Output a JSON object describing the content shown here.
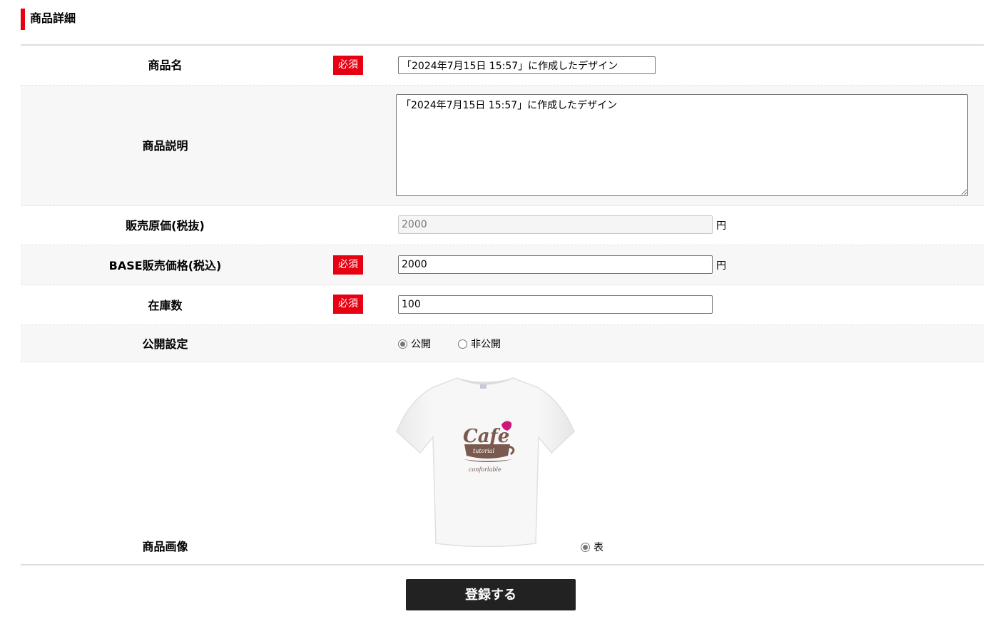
{
  "section_title": "商品詳細",
  "required_badge": "必須",
  "fields": {
    "name": {
      "label": "商品名",
      "value": "「2024年7月15日 15:57」に作成したデザイン"
    },
    "description": {
      "label": "商品説明",
      "value": "「2024年7月15日 15:57」に作成したデザイン"
    },
    "base_price": {
      "label": "販売原価(税抜)",
      "value": "2000",
      "unit": "円"
    },
    "sale_price": {
      "label": "BASE販売価格(税込)",
      "value": "2000",
      "unit": "円"
    },
    "stock": {
      "label": "在庫数",
      "value": "100"
    },
    "visibility": {
      "label": "公開設定",
      "options": [
        "公開",
        "非公開"
      ],
      "selected": "公開"
    },
    "image": {
      "label": "商品画像",
      "side_option": "表",
      "print_text": [
        "Cafe",
        "tutorial",
        "conforlable"
      ]
    }
  },
  "submit_label": "登録する",
  "colors": {
    "accent": "#e60012",
    "button": "#222222",
    "print_brown": "#7a5a4f",
    "print_pink": "#d0167a"
  }
}
